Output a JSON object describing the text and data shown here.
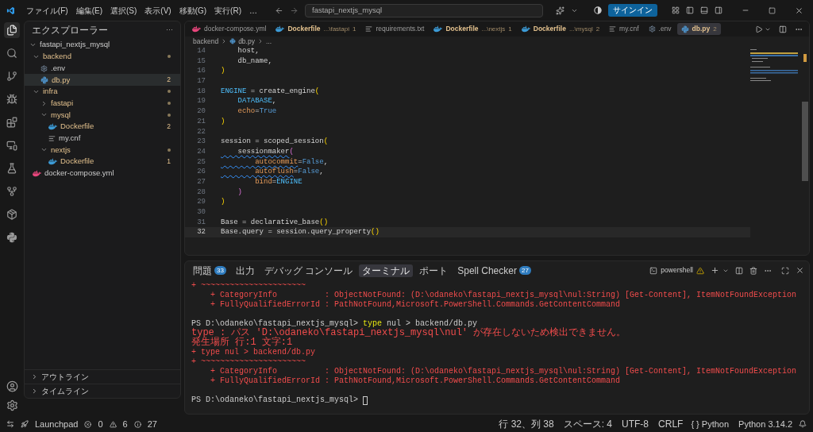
{
  "titlebar": {
    "menus": [
      "ファイル(F)",
      "編集(E)",
      "選択(S)",
      "表示(V)",
      "移動(G)",
      "実行(R)",
      "…"
    ],
    "search": "fastapi_nextjs_mysql",
    "signin": "サインイン"
  },
  "activity": [
    {
      "kind": "files",
      "selected": true
    },
    {
      "kind": "search",
      "selected": false
    },
    {
      "kind": "branch",
      "selected": false
    },
    {
      "kind": "debug",
      "selected": false
    },
    {
      "kind": "extensions",
      "selected": false
    },
    {
      "kind": "remote",
      "selected": false
    },
    {
      "kind": "flask",
      "selected": false
    },
    {
      "kind": "graph",
      "selected": false
    },
    {
      "kind": "package",
      "selected": false
    },
    {
      "kind": "python",
      "selected": false
    }
  ],
  "sidebar": {
    "title": "エクスプローラー",
    "more": "···",
    "root": "fastapi_nextjs_mysql",
    "tree": [
      {
        "label": "backend",
        "kind": "folder",
        "expanded": true,
        "modified": true,
        "children": [
          {
            "label": ".env",
            "kind": "gear",
            "selected": false
          },
          {
            "label": "db.py",
            "kind": "python",
            "badge": "2",
            "selected": true
          }
        ]
      },
      {
        "label": "infra",
        "kind": "folder",
        "expanded": true,
        "modified": true,
        "children": [
          {
            "label": "fastapi",
            "kind": "folder",
            "expanded": false,
            "modified": true
          },
          {
            "label": "mysql",
            "kind": "folder",
            "expanded": true,
            "modified": true,
            "children": [
              {
                "label": "Dockerfile",
                "kind": "docker",
                "badge": "2",
                "selected": false
              },
              {
                "label": "my.cnf",
                "kind": "lines",
                "selected": false
              }
            ]
          },
          {
            "label": "nextjs",
            "kind": "folder",
            "expanded": true,
            "modified": true,
            "children": [
              {
                "label": "Dockerfile",
                "kind": "docker",
                "badge": "1",
                "selected": false
              }
            ]
          }
        ]
      },
      {
        "label": "docker-compose.yml",
        "kind": "compose",
        "selected": false
      }
    ],
    "sections": [
      {
        "label": "アウトライン",
        "expanded": false
      },
      {
        "label": "タイムライン",
        "expanded": false
      }
    ]
  },
  "tabs": [
    {
      "label": "docker-compose.yml",
      "kind": "compose",
      "warn": false,
      "selected": false
    },
    {
      "label": "Dockerfile",
      "path": "...\\fastapi",
      "badge": "1",
      "kind": "docker",
      "warn": true,
      "selected": false
    },
    {
      "label": "requirements.txt",
      "kind": "lines",
      "warn": false,
      "selected": false
    },
    {
      "label": "Dockerfile",
      "path": "...\\nextjs",
      "badge": "1",
      "kind": "docker",
      "warn": true,
      "selected": false
    },
    {
      "label": "Dockerfile",
      "path": "...\\mysql",
      "badge": "2",
      "kind": "docker",
      "warn": true,
      "selected": false
    },
    {
      "label": "my.cnf",
      "kind": "lines",
      "warn": false,
      "selected": false
    },
    {
      "label": ".env",
      "kind": "gear",
      "warn": false,
      "selected": false
    },
    {
      "label": "db.py",
      "badge": "2",
      "kind": "python",
      "warn": true,
      "selected": true
    }
  ],
  "breadcrumb": [
    "backend",
    "db.py",
    "..."
  ],
  "code": [
    {
      "n": "14",
      "tokens": [
        {
          "t": "    host,",
          "kind": "plain"
        }
      ]
    },
    {
      "n": "15",
      "tokens": [
        {
          "t": "    db_name,",
          "kind": "plain"
        }
      ]
    },
    {
      "n": "16",
      "tokens": [
        {
          "t": ")",
          "kind": "b1"
        }
      ]
    },
    {
      "n": "17"
    },
    {
      "n": "18",
      "tokens": [
        {
          "t": "ENGINE",
          "kind": "const"
        },
        {
          "t": " = create_engine",
          "kind": "plain"
        },
        {
          "t": "(",
          "kind": "b1"
        }
      ]
    },
    {
      "n": "19",
      "tokens": [
        {
          "t": "    DATABASE",
          "kind": "const"
        },
        {
          "t": ",",
          "kind": "plain"
        }
      ]
    },
    {
      "n": "20",
      "tokens": [
        {
          "t": "    echo",
          "kind": "param"
        },
        {
          "t": "=",
          "kind": "plain"
        },
        {
          "t": "True",
          "kind": "keyword"
        }
      ]
    },
    {
      "n": "21",
      "tokens": [
        {
          "t": ")",
          "kind": "b1"
        }
      ]
    },
    {
      "n": "22"
    },
    {
      "n": "23",
      "tokens": [
        {
          "t": "session = scoped_session",
          "kind": "plain"
        },
        {
          "t": "(",
          "kind": "b1"
        }
      ]
    },
    {
      "n": "24",
      "tokens": [
        {
          "t": "    sessionmaker",
          "kind": "plain",
          "warn": true
        },
        {
          "t": "(",
          "kind": "b2"
        }
      ]
    },
    {
      "n": "25",
      "tokens": [
        {
          "t": "        autocommit",
          "kind": "param",
          "warn": true
        },
        {
          "t": "=",
          "kind": "plain"
        },
        {
          "t": "False",
          "kind": "keyword"
        },
        {
          "t": ",",
          "kind": "plain"
        }
      ]
    },
    {
      "n": "26",
      "tokens": [
        {
          "t": "        autoflush",
          "kind": "param",
          "warn": true
        },
        {
          "t": "=",
          "kind": "plain"
        },
        {
          "t": "False",
          "kind": "keyword"
        },
        {
          "t": ",",
          "kind": "plain"
        }
      ]
    },
    {
      "n": "27",
      "tokens": [
        {
          "t": "        bind",
          "kind": "param"
        },
        {
          "t": "=",
          "kind": "plain"
        },
        {
          "t": "ENGINE",
          "kind": "const"
        }
      ]
    },
    {
      "n": "28",
      "tokens": [
        {
          "t": "    )",
          "kind": "b2"
        }
      ]
    },
    {
      "n": "29",
      "tokens": [
        {
          "t": ")",
          "kind": "b1"
        }
      ]
    },
    {
      "n": "30"
    },
    {
      "n": "31",
      "tokens": [
        {
          "t": "Base = declarative_base",
          "kind": "plain"
        },
        {
          "t": "()",
          "kind": "b1"
        }
      ]
    },
    {
      "n": "32",
      "current": true,
      "tokens": [
        {
          "t": "Base.query = session.query_property",
          "kind": "plain"
        },
        {
          "t": "()",
          "kind": "b1"
        }
      ]
    }
  ],
  "panel": {
    "tabs": [
      {
        "label": "問題",
        "badge": "33",
        "selected": false
      },
      {
        "label": "出力",
        "selected": false
      },
      {
        "label": "デバッグ コンソール",
        "selected": false
      },
      {
        "label": "ターミナル",
        "selected": true
      },
      {
        "label": "ポート",
        "selected": false
      },
      {
        "label": "Spell Checker",
        "badge": "27",
        "selected": false
      }
    ],
    "shell": "powershell",
    "terminal": [
      {
        "spaced": false,
        "parts": [
          {
            "t": "+ ~~~~~~~~~~~~~~~~~~~~~~",
            "kind": "error"
          }
        ]
      },
      {
        "spaced": false,
        "parts": [
          {
            "t": "    + CategoryInfo          : ObjectNotFound: (D:\\odaneko\\fastapi_nextjs_mysql\\nul:String) [Get-Content], ItemNotFoundException",
            "kind": "error"
          }
        ]
      },
      {
        "spaced": false,
        "parts": [
          {
            "t": "    + FullyQualifiedErrorId : PathNotFound,Microsoft.PowerShell.Commands.GetContentCommand",
            "kind": "error"
          }
        ]
      },
      {
        "spaced": true,
        "parts": [
          {
            "t": "PS D:\\odaneko\\fastapi_nextjs_mysql> ",
            "kind": "prompt"
          },
          {
            "t": "type",
            "kind": "command"
          },
          {
            "t": " nul > backend/db.py",
            "kind": "prompt"
          }
        ]
      },
      {
        "spaced": false,
        "parts": [
          {
            "t": "type : パス 'D:\\odaneko\\fastapi_nextjs_mysql\\nul' が存在しないため検出できません。",
            "kind": "localized"
          }
        ]
      },
      {
        "spaced": false,
        "parts": [
          {
            "t": "発生場所 行:1 文字:1",
            "kind": "localized"
          }
        ]
      },
      {
        "spaced": false,
        "parts": [
          {
            "t": "+ type nul > backend/db.py",
            "kind": "error"
          }
        ]
      },
      {
        "spaced": false,
        "parts": [
          {
            "t": "+ ~~~~~~~~~~~~~~~~~~~~~~",
            "kind": "error"
          }
        ]
      },
      {
        "spaced": false,
        "parts": [
          {
            "t": "    + CategoryInfo          : ObjectNotFound: (D:\\odaneko\\fastapi_nextjs_mysql\\nul:String) [Get-Content], ItemNotFoundException",
            "kind": "error"
          }
        ]
      },
      {
        "spaced": false,
        "parts": [
          {
            "t": "    + FullyQualifiedErrorId : PathNotFound,Microsoft.PowerShell.Commands.GetContentCommand",
            "kind": "error"
          }
        ]
      },
      {
        "spaced": true,
        "cursor": true,
        "parts": [
          {
            "t": "PS D:\\odaneko\\fastapi_nextjs_mysql> ",
            "kind": "prompt"
          }
        ]
      }
    ]
  },
  "status": {
    "launchpad": "Launchpad",
    "errors": "0",
    "warnings": "6",
    "infos": "27",
    "right": [
      "行 32、列 38",
      "スペース: 4",
      "UTF-8",
      "CRLF"
    ],
    "braces": "{ }",
    "language": "Python",
    "interpreter": "Python 3.14.2"
  }
}
